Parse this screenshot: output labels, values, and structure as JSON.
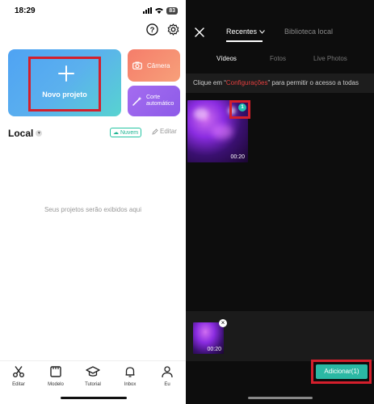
{
  "status_bar": {
    "time": "18:29",
    "battery": "83"
  },
  "left": {
    "new_project_label": "Novo projeto",
    "camera_label": "Câmera",
    "auto_cut_line1": "Corte",
    "auto_cut_line2": "automático",
    "local_title": "Local",
    "new_badge": "Nuvem",
    "edit_label": "Editar",
    "empty_message": "Seus projetos serão exibidos aqui",
    "nav": [
      {
        "label": "Editar",
        "icon": "scissors-icon"
      },
      {
        "label": "Modelo",
        "icon": "template-icon"
      },
      {
        "label": "Tutorial",
        "icon": "graduation-cap-icon"
      },
      {
        "label": "Inbox",
        "icon": "bell-icon"
      },
      {
        "label": "Eu",
        "icon": "person-icon"
      }
    ]
  },
  "right": {
    "tab_recent": "Recentes",
    "tab_library": "Biblioteca local",
    "subtabs": [
      "Vídeos",
      "Fotos",
      "Live Photos"
    ],
    "permission_prefix": "Clique em “",
    "permission_link": "Configurações",
    "permission_suffix": "” para permitir o acesso a todas",
    "video_duration": "00:20",
    "selection_number": "1",
    "selected_duration": "00:20",
    "add_button": "Adicionar(1)"
  },
  "colors": {
    "highlight_red": "#d41f2c",
    "accent_teal": "#2bb8a4",
    "link_red": "#e53f3f"
  }
}
